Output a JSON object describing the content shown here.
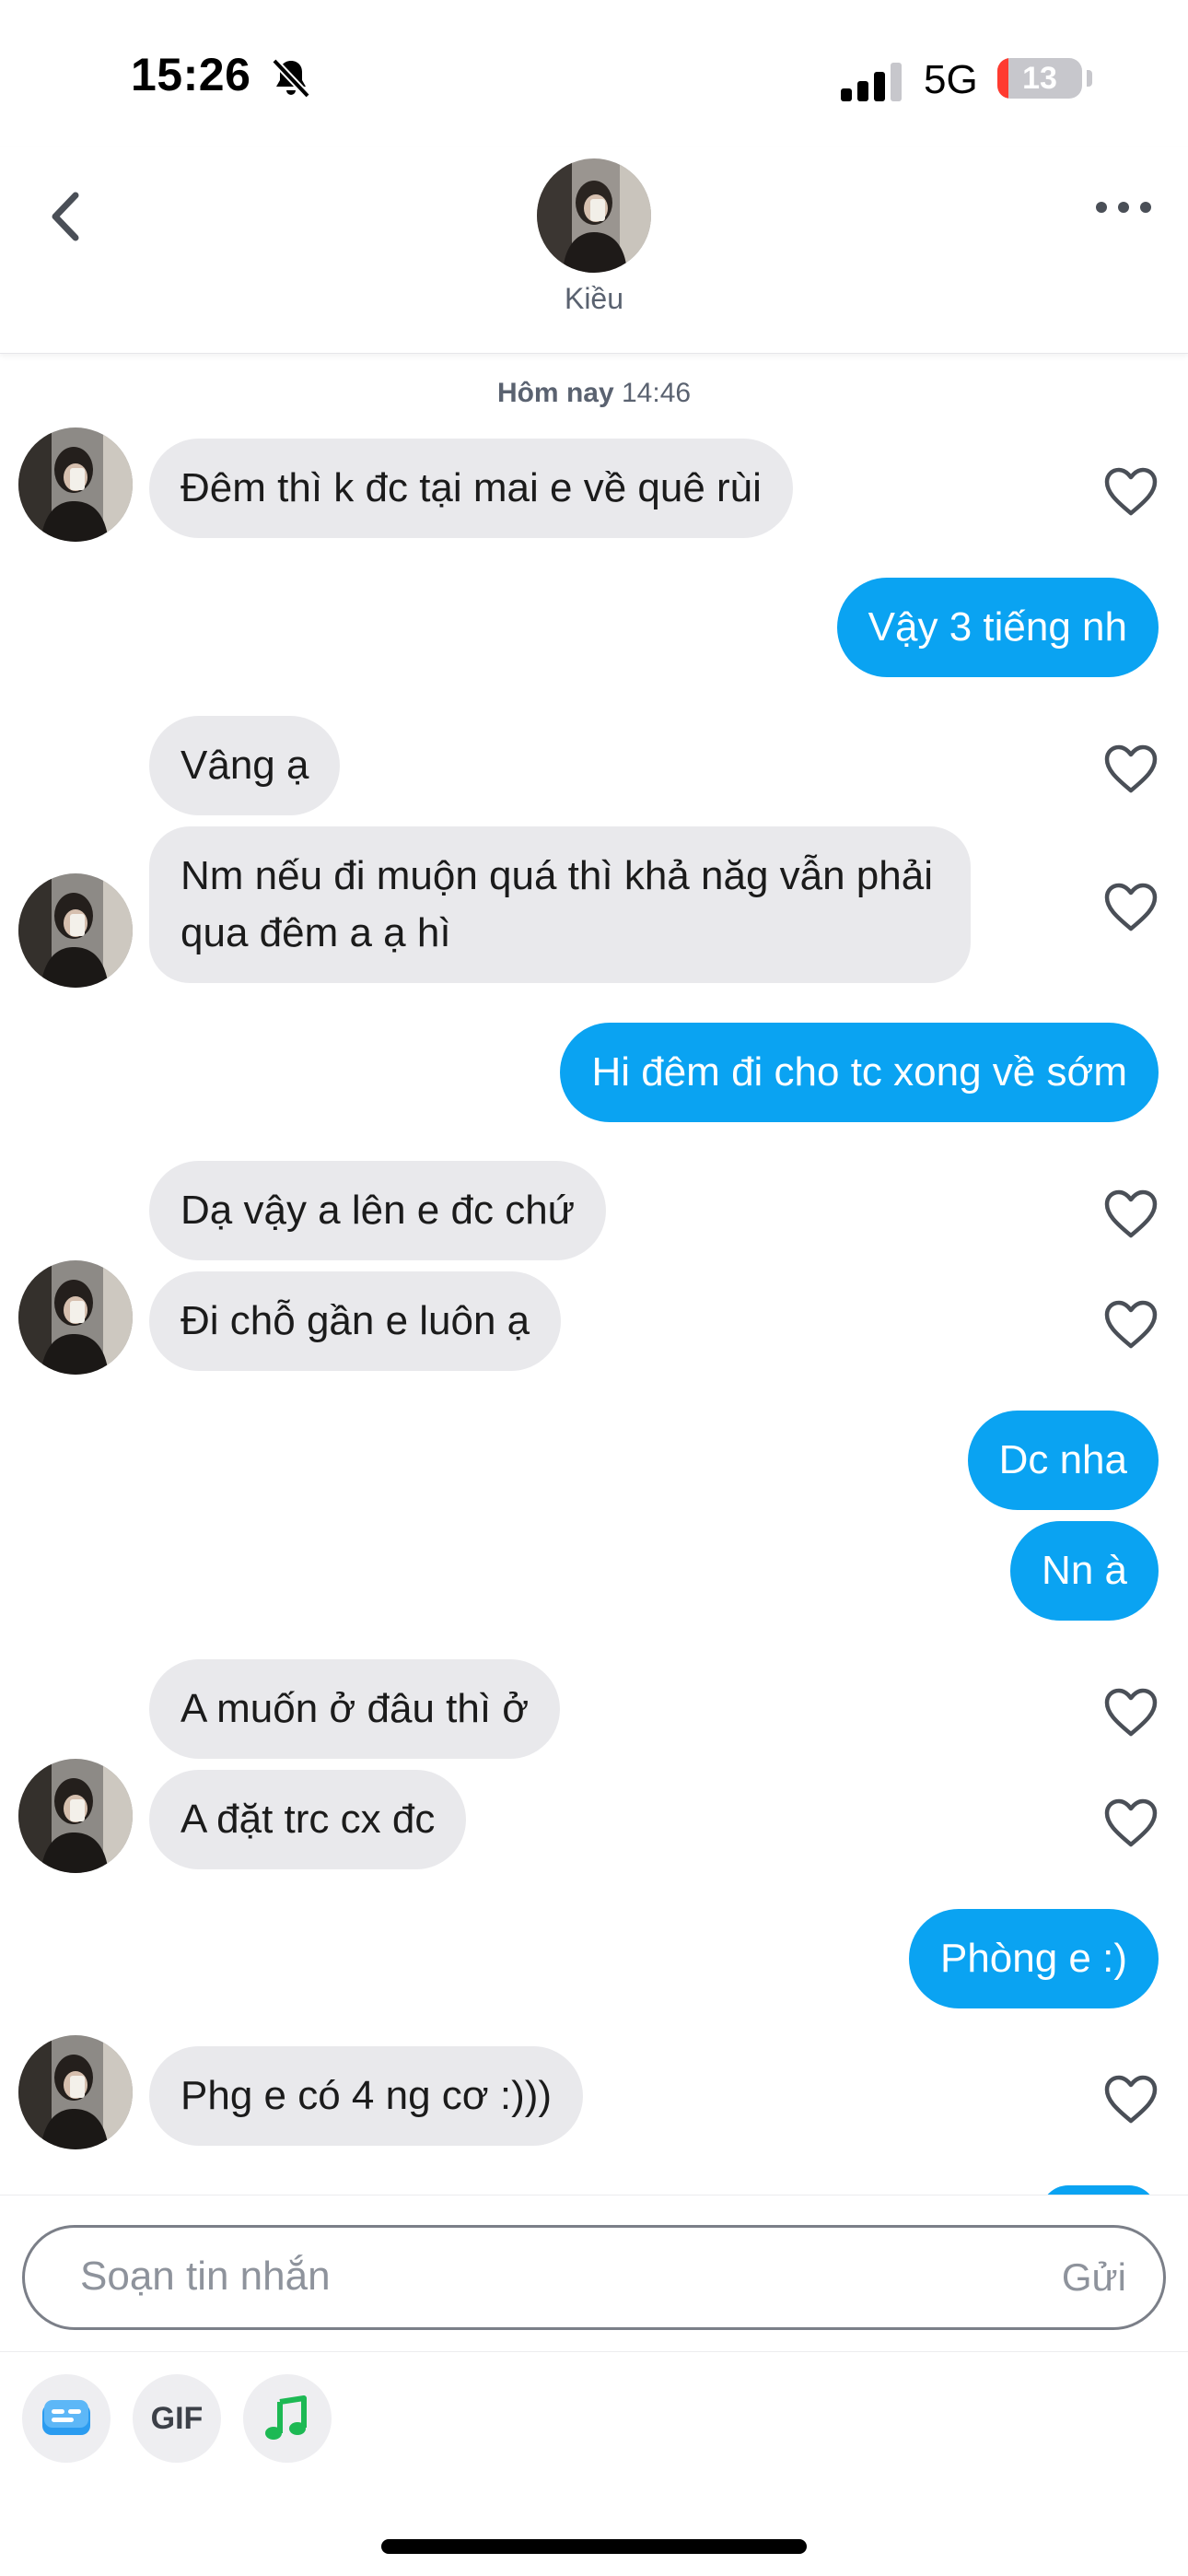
{
  "status": {
    "time": "15:26",
    "network": "5G",
    "battery": "13",
    "battery_level": 0.13,
    "icons": [
      "bell-slash-icon",
      "signal-icon",
      "battery-icon"
    ]
  },
  "header": {
    "contact_name": "Kiều",
    "icons": [
      "chevron-left-icon",
      "more-icon"
    ]
  },
  "conversation": {
    "date_day": "Hôm nay",
    "date_time": "14:46",
    "messages": [
      {
        "sender": "them",
        "text": "Đêm thì k đc tại mai e về quê rùi"
      },
      {
        "sender": "me",
        "text": "Vậy 3 tiếng nh"
      },
      {
        "sender": "them",
        "text": "Vâng ạ"
      },
      {
        "sender": "them",
        "text": "Nm nếu đi muộn quá thì khả năg vẫn phải qua đêm a ạ hì"
      },
      {
        "sender": "me",
        "text": "Hi đêm đi cho tc xong về sớm"
      },
      {
        "sender": "them",
        "text": "Dạ vậy a lên e đc chứ"
      },
      {
        "sender": "them",
        "text": "Đi chỗ gần e luôn ạ"
      },
      {
        "sender": "me",
        "text": "Dc nha"
      },
      {
        "sender": "me",
        "text": "Nn à"
      },
      {
        "sender": "them",
        "text": "A muốn ở đâu thì ở"
      },
      {
        "sender": "them",
        "text": "A đặt trc cx đc"
      },
      {
        "sender": "me",
        "text": "Phòng e :)"
      },
      {
        "sender": "them",
        "text": "Phg e có 4 ng cơ :)))"
      }
    ]
  },
  "composer": {
    "placeholder": "Soạn tin nhắn",
    "send_label": "Gửi"
  },
  "toolbar": {
    "gif_label": "GIF",
    "icons": [
      "card-icon",
      "gif-icon",
      "music-icon"
    ]
  },
  "colors": {
    "outgoing_bubble": "#0aa3f2",
    "incoming_bubble": "#e9e9ec",
    "heart": "#4a4f57",
    "music": "#1db954",
    "card": "#2b9cf0"
  }
}
